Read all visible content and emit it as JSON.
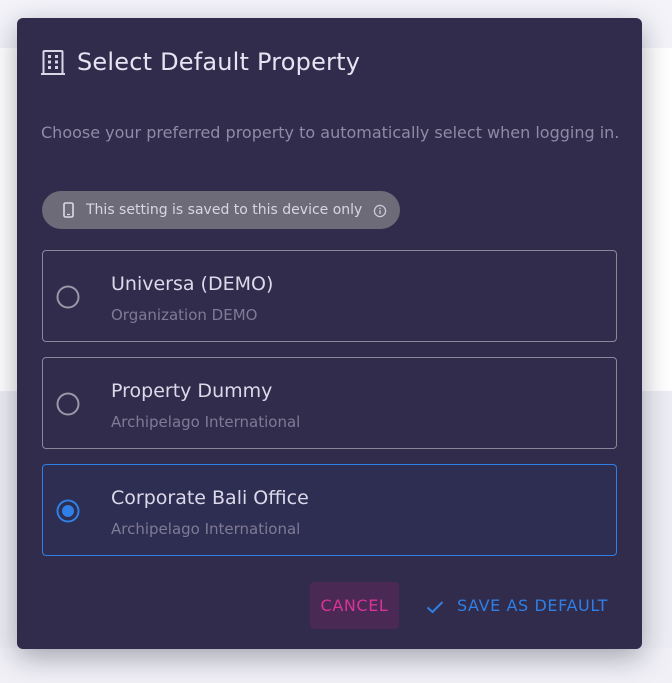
{
  "dialog": {
    "title": "Select Default Property",
    "description": "Choose your preferred property to automatically select when logging in.",
    "notice": {
      "text": "This setting is saved to this device only",
      "leading_icon": "phone-icon",
      "trailing_icon": "info-icon"
    },
    "options": [
      {
        "name": "Universa (DEMO)",
        "subtitle": "Organization DEMO",
        "selected": false
      },
      {
        "name": "Property Dummy",
        "subtitle": "Archipelago International",
        "selected": false
      },
      {
        "name": "Corporate Bali Office",
        "subtitle": "Archipelago International",
        "selected": true
      }
    ],
    "actions": {
      "cancel_label": "CANCEL",
      "save_label": "SAVE AS DEFAULT",
      "save_icon": "check-icon"
    }
  },
  "colors": {
    "dialog_bg": "#312c4b",
    "accent_blue": "#2f7fe6",
    "cancel_text": "#d9339a",
    "cancel_bg": "#4a2a55"
  }
}
